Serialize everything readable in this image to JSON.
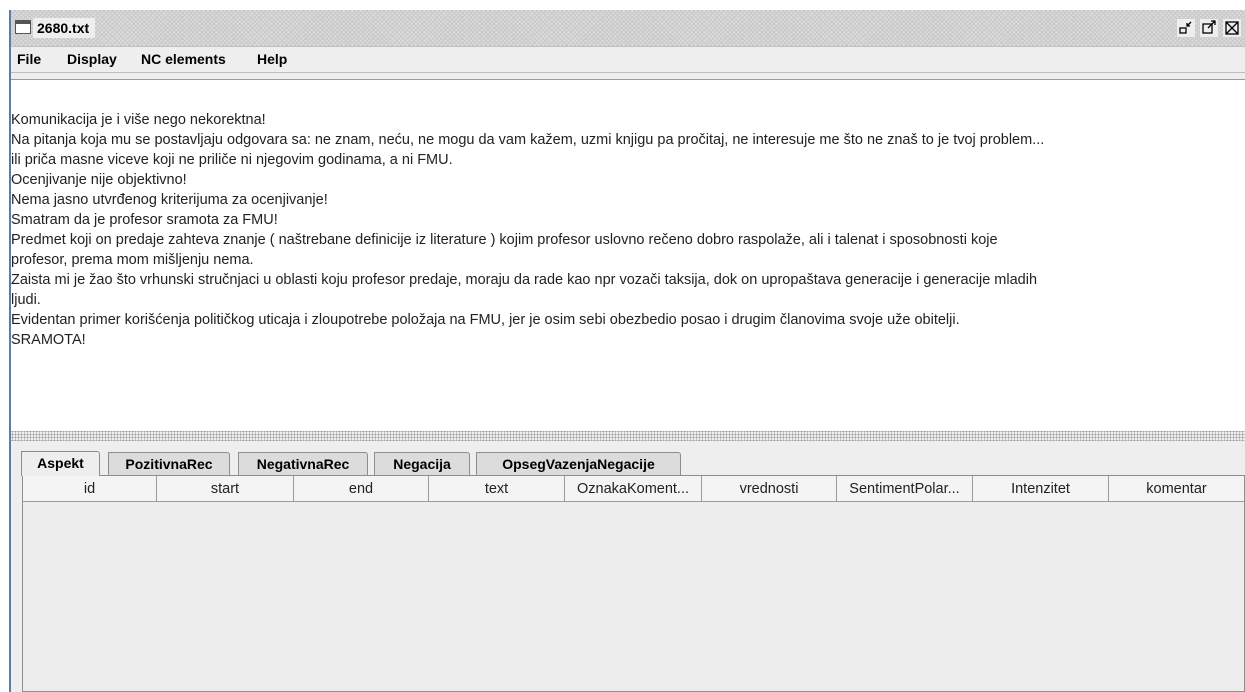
{
  "window": {
    "title": "2680.txt",
    "icons": {
      "window_icon": "window-icon",
      "iconify": "iconify-icon",
      "maximize": "maximize-icon",
      "close": "close-icon"
    }
  },
  "menu": {
    "items": [
      {
        "label": "File"
      },
      {
        "label": "Display"
      },
      {
        "label": "NC elements"
      },
      {
        "label": "Help"
      }
    ]
  },
  "document": {
    "lines": [
      "Komunikacija je i više nego nekorektna!",
      "Na pitanja koja mu se postavljaju odgovara sa: ne znam, neću, ne mogu da vam kažem, uzmi knjigu pa pročitaj, ne interesuje me što ne znaš to je tvoj problem...",
      "ili priča masne viceve koji ne priliče ni njegovim godinama, a ni FMU.",
      "Ocenjivanje nije objektivno!",
      "Nema jasno utvrđenog kriterijuma za ocenjivanje!",
      "Smatram da je profesor sramota za FMU!",
      "Predmet koji on predaje zahteva znanje ( naštrebane definicije iz literature ) kojim profesor uslovno rečeno dobro raspolaže, ali i talenat i sposobnosti koje",
      "profesor, prema mom mišljenju nema.",
      "Zaista mi je žao što vrhunski stručnjaci u oblasti koju profesor predaje, moraju da rade kao npr vozači taksija, dok on upropaštava generacije i generacije mladih",
      "ljudi.",
      "Evidentan primer korišćenja političkog uticaja i zloupotrebe položaja na FMU, jer je osim sebi obezbedio posao i drugim članovima svoje uže obitelji.",
      "SRAMOTA!"
    ]
  },
  "tabs": {
    "items": [
      {
        "label": "Aspekt",
        "selected": true
      },
      {
        "label": "PozitivnaRec",
        "selected": false
      },
      {
        "label": "NegativnaRec",
        "selected": false
      },
      {
        "label": "Negacija",
        "selected": false
      },
      {
        "label": "OpsegVazenjaNegacije",
        "selected": false
      }
    ]
  },
  "table": {
    "columns": [
      {
        "label": "id"
      },
      {
        "label": "start"
      },
      {
        "label": "end"
      },
      {
        "label": "text"
      },
      {
        "label": "OznakaKoment..."
      },
      {
        "label": "vrednosti"
      },
      {
        "label": "SentimentPolar..."
      },
      {
        "label": "Intenzitet"
      },
      {
        "label": "komentar"
      }
    ],
    "rows": []
  }
}
